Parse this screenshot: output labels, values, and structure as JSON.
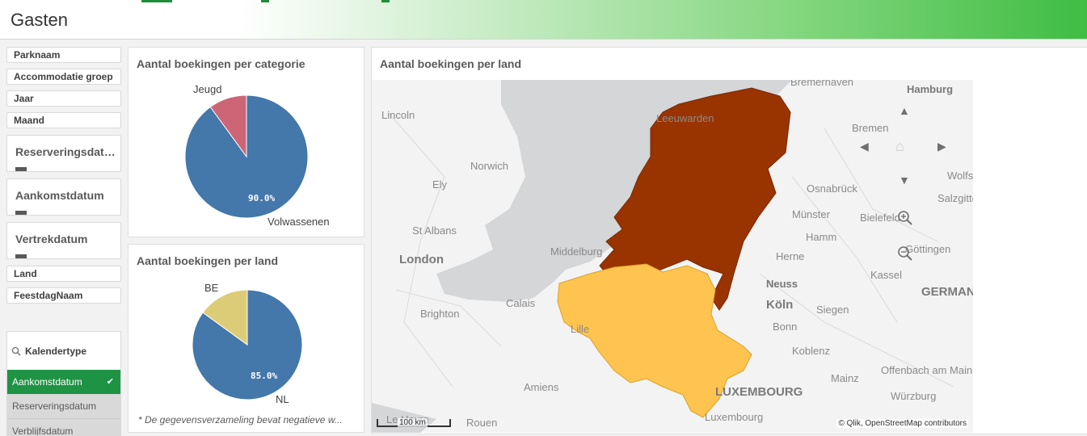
{
  "app": {
    "title": "Gasten"
  },
  "filters": [
    {
      "label": "Parknaam"
    },
    {
      "label": "Accommodatie groep"
    },
    {
      "label": "Jaar"
    },
    {
      "label": "Maand"
    }
  ],
  "filters_big": [
    {
      "label": "Reserveringsdatum"
    },
    {
      "label": "Aankomstdatum"
    },
    {
      "label": "Vertrekdatum"
    }
  ],
  "filters_bottom": [
    {
      "label": "Land"
    },
    {
      "label": "FeestdagNaam"
    }
  ],
  "kalender": {
    "label": "Kalendertype",
    "options": [
      "Aankomstdatum",
      "Reserveringsdatum",
      "Verblijfsdatum"
    ],
    "selected": "Aankomstdatum"
  },
  "category_chart": {
    "title": "Aantal boekingen per categorie",
    "chart_data": {
      "type": "pie",
      "categories": [
        "Volwassenen",
        "Jeugd"
      ],
      "values": [
        90.0,
        10.0
      ],
      "data_label": "90.0%",
      "colors": [
        "#4477aa",
        "#cc6677"
      ]
    }
  },
  "country_chart": {
    "title": "Aantal boekingen per land",
    "chart_data": {
      "type": "pie",
      "categories": [
        "NL",
        "BE"
      ],
      "values": [
        85.0,
        15.0
      ],
      "data_label": "85.0%",
      "colors": [
        "#4477aa",
        "#ddcc77"
      ]
    },
    "note": "* De gegevensverzameling bevat negatieve w..."
  },
  "map_panel": {
    "title": "Aantal boekingen per land",
    "countries": {
      "NL": "#993300",
      "BE": "#fec44f"
    },
    "places": [
      "Bremerhaven",
      "Hamburg",
      "Lincoln",
      "Leeuwarden",
      "Bremen",
      "Norwich",
      "Wolfsburg",
      "Ely",
      "Osnabrück",
      "Salzgitter",
      "Münster",
      "Bielefeld",
      "St Albans",
      "Hamm",
      "Göttingen",
      "London",
      "Middelburg",
      "Herne",
      "Kassel",
      "Neuss",
      "GERMANY",
      "Calais",
      "Köln",
      "Siegen",
      "Brighton",
      "Bonn",
      "Lille",
      "Koblenz",
      "Mainz",
      "Offenbach am Main",
      "Amiens",
      "LUXEMBOURG",
      "Würzburg",
      "Luxembourg",
      "Le Havre",
      "Rouen"
    ],
    "scale": "100 km",
    "attribution": "© Qlik, OpenStreetMap contributors"
  },
  "icons": [
    "search-icon",
    "check-icon",
    "calendar-icon",
    "pan-up-icon",
    "pan-left-icon",
    "pan-right-icon",
    "pan-down-icon",
    "home-icon",
    "zoom-in-icon",
    "zoom-out-icon"
  ]
}
